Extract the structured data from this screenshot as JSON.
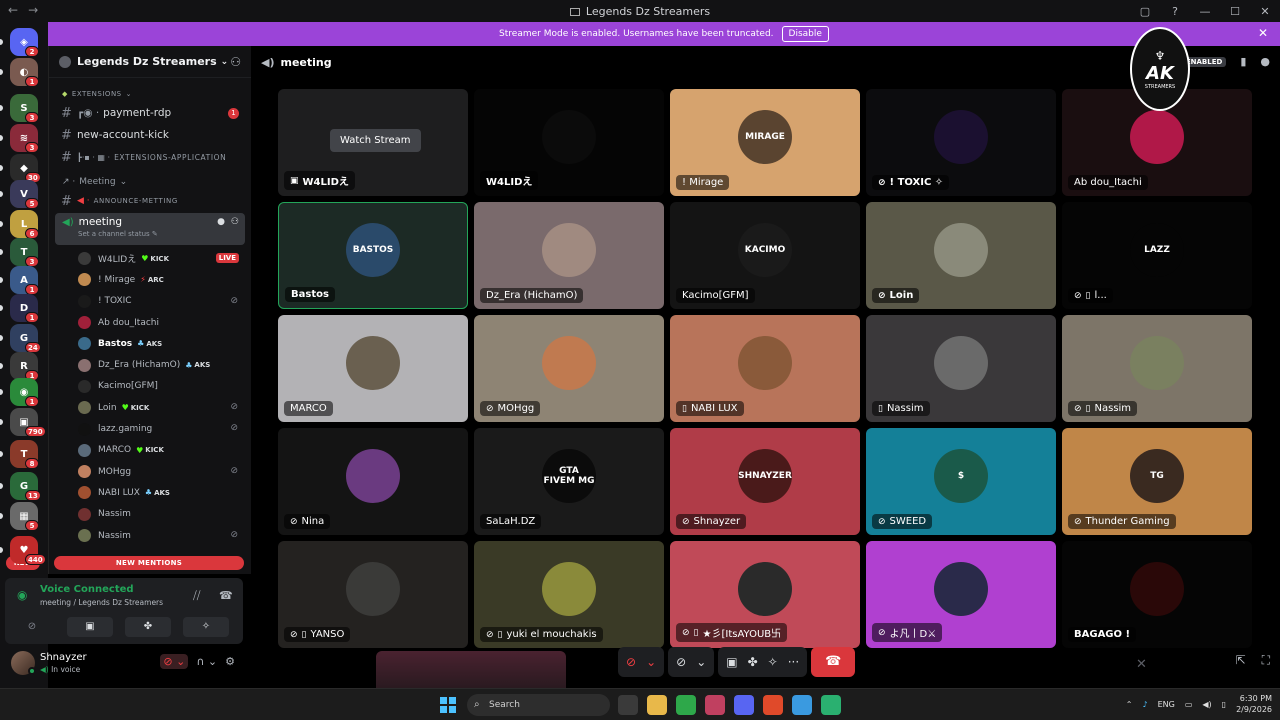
{
  "window": {
    "title": "Legends Dz Streamers",
    "back_icon": "←",
    "forward_icon": "→"
  },
  "banner": {
    "text": "Streamer Mode is enabled. Usernames have been truncated.",
    "button": "Disable"
  },
  "rail": {
    "badges": [
      "2",
      "1",
      "3",
      "3",
      "30",
      "5",
      "6",
      "3",
      "1",
      "1",
      "24",
      "1",
      "1",
      "790",
      "8",
      "13",
      "5",
      "440"
    ],
    "new_label": "NEW"
  },
  "sidebar": {
    "guild_name": "Legends Dz Streamers",
    "cat_extensions": "extensions",
    "channels": [
      {
        "name": "payment-rdp",
        "badge": "1"
      },
      {
        "name": "new-account-kick",
        "badge": ""
      },
      {
        "name": "extensions-application",
        "badge": ""
      }
    ],
    "cat_meeting": "Meeting",
    "announce_channel": "announce-metting",
    "voice_channel": "meeting",
    "channel_status": "Set a channel status",
    "voice_users": [
      {
        "name": "W4LIDえ",
        "tag": "KICK",
        "live": "LIVE",
        "muted": false,
        "color": "#3a3a3a"
      },
      {
        "name": "! Mirage",
        "tag": "ARC",
        "live": "",
        "muted": false,
        "color": "#c08a50"
      },
      {
        "name": "! TOXIC",
        "tag": "",
        "live": "",
        "muted": true,
        "color": "#1a1a1a"
      },
      {
        "name": "Ab dou_Itachi",
        "tag": "",
        "live": "",
        "muted": false,
        "color": "#a0203a"
      },
      {
        "name": "Bastos",
        "tag": "AKS",
        "live": "",
        "muted": false,
        "color": "#3a6a8a"
      },
      {
        "name": "Dz_Era (HichamO)",
        "tag": "AKS",
        "live": "",
        "muted": false,
        "color": "#8a7070"
      },
      {
        "name": "Kacimo[GFM]",
        "tag": "",
        "live": "",
        "muted": false,
        "color": "#2a2a2a"
      },
      {
        "name": "Loin",
        "tag": "KICK",
        "live": "",
        "muted": true,
        "color": "#6a6a50"
      },
      {
        "name": "lazz.gaming",
        "tag": "",
        "live": "",
        "muted": true,
        "color": "#111111"
      },
      {
        "name": "MARCO",
        "tag": "KICK",
        "live": "",
        "muted": false,
        "color": "#5a6a7a"
      },
      {
        "name": "MOHgg",
        "tag": "",
        "live": "",
        "muted": true,
        "color": "#c08060"
      },
      {
        "name": "NABI LUX",
        "tag": "AKS",
        "live": "",
        "muted": false,
        "color": "#a05030"
      },
      {
        "name": "Nassim",
        "tag": "",
        "live": "",
        "muted": false,
        "color": "#703030"
      },
      {
        "name": "Nassim",
        "tag": "",
        "live": "",
        "muted": true,
        "color": "#6a7050"
      }
    ],
    "new_mentions": "NEW MENTIONS"
  },
  "voice_panel": {
    "status": "Voice Connected",
    "location": "meeting / Legends Dz Streamers"
  },
  "user_bar": {
    "name": "Shnayzer",
    "status": "In voice"
  },
  "main": {
    "channel": "meeting",
    "enabled_badge": "ENABLED",
    "watch_stream": "Watch Stream",
    "tiles": [
      {
        "name": "W4LIDえ",
        "bg": "#1e1e1f",
        "pic": "#1e1e1f",
        "icon": "screen",
        "bold": true,
        "txt": ""
      },
      {
        "name": "W4LIDえ",
        "bg": "#050505",
        "pic": "#0b0b0b",
        "icon": "",
        "bold": true,
        "txt": ""
      },
      {
        "name": "! Mirage",
        "bg": "#d6a36e",
        "pic": "#5a4430",
        "icon": "",
        "bold": false,
        "txt": "MIRAGE"
      },
      {
        "name": "! TOXIC ✧",
        "bg": "#0c0c0e",
        "pic": "#1b1030",
        "icon": "muted",
        "bold": true,
        "txt": ""
      },
      {
        "name": "Ab dou_Itachi",
        "bg": "#1a0e10",
        "pic": "#b01848",
        "icon": "",
        "bold": false,
        "txt": ""
      },
      {
        "name": "Bastos",
        "bg": "#1c2a25",
        "pic": "#2a4a6a",
        "icon": "",
        "bold": true,
        "txt": "BASTOS"
      },
      {
        "name": "Dz_Era (HichamO)",
        "bg": "#7a6a6c",
        "pic": "#a08a80",
        "icon": "",
        "bold": false,
        "txt": ""
      },
      {
        "name": "Kacimo[GFM]",
        "bg": "#141414",
        "pic": "#1a1a1a",
        "icon": "",
        "bold": false,
        "txt": "KACIMO"
      },
      {
        "name": "Loin",
        "bg": "#5a5848",
        "pic": "#8a8a7a",
        "icon": "muted",
        "bold": true,
        "txt": ""
      },
      {
        "name": "l...",
        "bg": "#050505",
        "pic": "#050505",
        "icon": "muted-phone",
        "bold": false,
        "txt": "LAZZ"
      },
      {
        "name": "MARCO",
        "bg": "#b3b2b5",
        "pic": "#6a6050",
        "icon": "",
        "bold": false,
        "txt": ""
      },
      {
        "name": "MOHgg",
        "bg": "#8e8474",
        "pic": "#c07a50",
        "icon": "muted",
        "bold": false,
        "txt": ""
      },
      {
        "name": "NABI LUX",
        "bg": "#b8745a",
        "pic": "#8a5a3a",
        "icon": "phone",
        "bold": false,
        "txt": ""
      },
      {
        "name": "Nassim",
        "bg": "#3a383a",
        "pic": "#6a6a6a",
        "icon": "phone",
        "bold": false,
        "txt": ""
      },
      {
        "name": "Nassim",
        "bg": "#7d7568",
        "pic": "#7a8060",
        "icon": "muted-phone",
        "bold": false,
        "txt": ""
      },
      {
        "name": "Nina",
        "bg": "#141414",
        "pic": "#6a3a80",
        "icon": "muted",
        "bold": false,
        "txt": ""
      },
      {
        "name": "SaLaH.DZ",
        "bg": "#1a1a1a",
        "pic": "#0b0b0b",
        "icon": "",
        "bold": false,
        "txt": "GTA FIVEM MG"
      },
      {
        "name": "Shnayzer",
        "bg": "#b03c48",
        "pic": "#4a1a1a",
        "icon": "muted",
        "bold": false,
        "txt": "SHNAYZER"
      },
      {
        "name": "SWEED",
        "bg": "#148098",
        "pic": "#1a5a4a",
        "icon": "muted",
        "bold": false,
        "txt": "$"
      },
      {
        "name": "Thunder Gaming",
        "bg": "#c08648",
        "pic": "#3a2a20",
        "icon": "muted",
        "bold": false,
        "txt": "TG"
      },
      {
        "name": "YANSO",
        "bg": "#242220",
        "pic": "#3a3a38",
        "icon": "muted-phone",
        "bold": false,
        "txt": ""
      },
      {
        "name": "yuki el mouchakis",
        "bg": "#3a3a26",
        "pic": "#8a8a3a",
        "icon": "muted-phone",
        "bold": false,
        "txt": ""
      },
      {
        "name": "★彡[ItsAYOUB卐",
        "bg": "#c04a58",
        "pic": "#2a2a2a",
        "icon": "muted-phone",
        "bold": false,
        "txt": ""
      },
      {
        "name": "よ凡丨D⚔",
        "bg": "#b040d0",
        "pic": "#2a2a4a",
        "icon": "muted",
        "bold": false,
        "txt": ""
      },
      {
        "name": "BAGAGO !",
        "bg": "#050505",
        "pic": "#2a0808",
        "icon": "",
        "bold": true,
        "txt": ""
      }
    ]
  },
  "logo": {
    "big": "AK",
    "small": "STREAMERS"
  },
  "taskbar": {
    "search": "Search",
    "lang": "ENG",
    "time": "6:30 PM",
    "date": "2/9/2026"
  }
}
